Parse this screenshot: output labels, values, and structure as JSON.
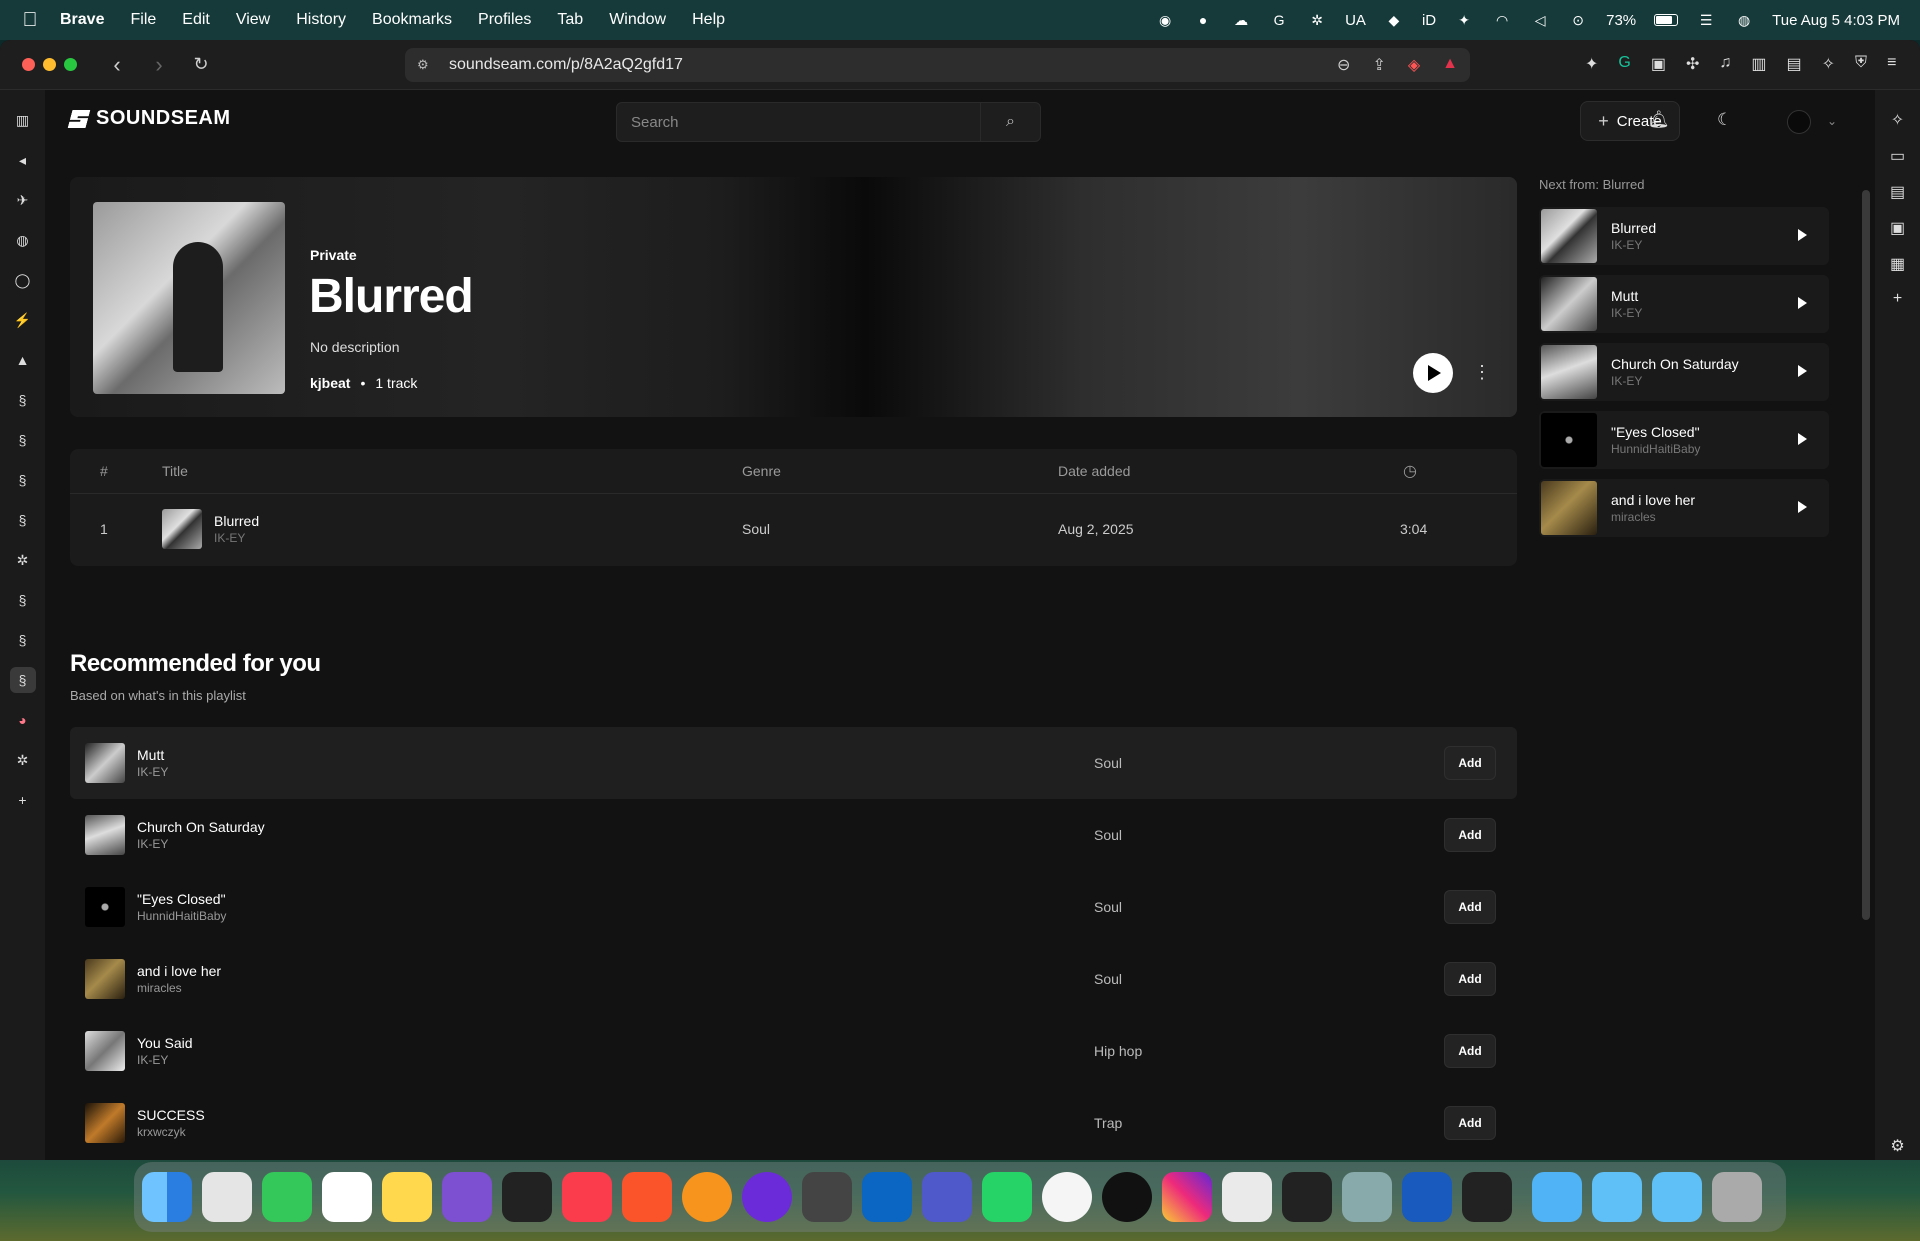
{
  "menubar": {
    "app": "Brave",
    "items": [
      "File",
      "Edit",
      "View",
      "History",
      "Bookmarks",
      "Profiles",
      "Tab",
      "Window",
      "Help"
    ],
    "status": {
      "region": "UA",
      "id": "iD",
      "battery": "73%",
      "datetime": "Tue Aug 5  4:03 PM"
    }
  },
  "browser": {
    "url": "soundseam.com/p/8A2aQ2gfd17"
  },
  "app": {
    "brand": "SOUNDSEAM",
    "search_placeholder": "Search",
    "create_label": "Create"
  },
  "playlist": {
    "visibility": "Private",
    "title": "Blurred",
    "description": "No description",
    "owner": "kjbeat",
    "separator": "•",
    "count": "1 track"
  },
  "tracks": {
    "headers": {
      "num": "#",
      "title": "Title",
      "genre": "Genre",
      "date": "Date added"
    },
    "rows": [
      {
        "num": "1",
        "title": "Blurred",
        "artist": "IK-EY",
        "genre": "Soul",
        "date": "Aug 2, 2025",
        "duration": "3:04"
      }
    ]
  },
  "recommended": {
    "heading": "Recommended for you",
    "subheading": "Based on what's in this playlist",
    "add_label": "Add",
    "items": [
      {
        "title": "Mutt",
        "artist": "IK-EY",
        "genre": "Soul"
      },
      {
        "title": "Church On Saturday",
        "artist": "IK-EY",
        "genre": "Soul"
      },
      {
        "title": "\"Eyes Closed\"",
        "artist": "HunnidHaitiBaby",
        "genre": "Soul"
      },
      {
        "title": "and i love her",
        "artist": "miracles",
        "genre": "Soul"
      },
      {
        "title": "You Said",
        "artist": "IK-EY",
        "genre": "Hip hop"
      },
      {
        "title": "SUCCESS",
        "artist": "krxwczyk",
        "genre": "Trap"
      }
    ]
  },
  "next": {
    "label": "Next from: Blurred",
    "items": [
      {
        "title": "Blurred",
        "artist": "IK-EY"
      },
      {
        "title": "Mutt",
        "artist": "IK-EY"
      },
      {
        "title": "Church On Saturday",
        "artist": "IK-EY"
      },
      {
        "title": "\"Eyes Closed\"",
        "artist": "HunnidHaitiBaby"
      },
      {
        "title": "and i love her",
        "artist": "miracles"
      }
    ]
  },
  "colors": {
    "background": "#121212",
    "panel": "#1b1b1b",
    "accent": "#ffffff"
  }
}
